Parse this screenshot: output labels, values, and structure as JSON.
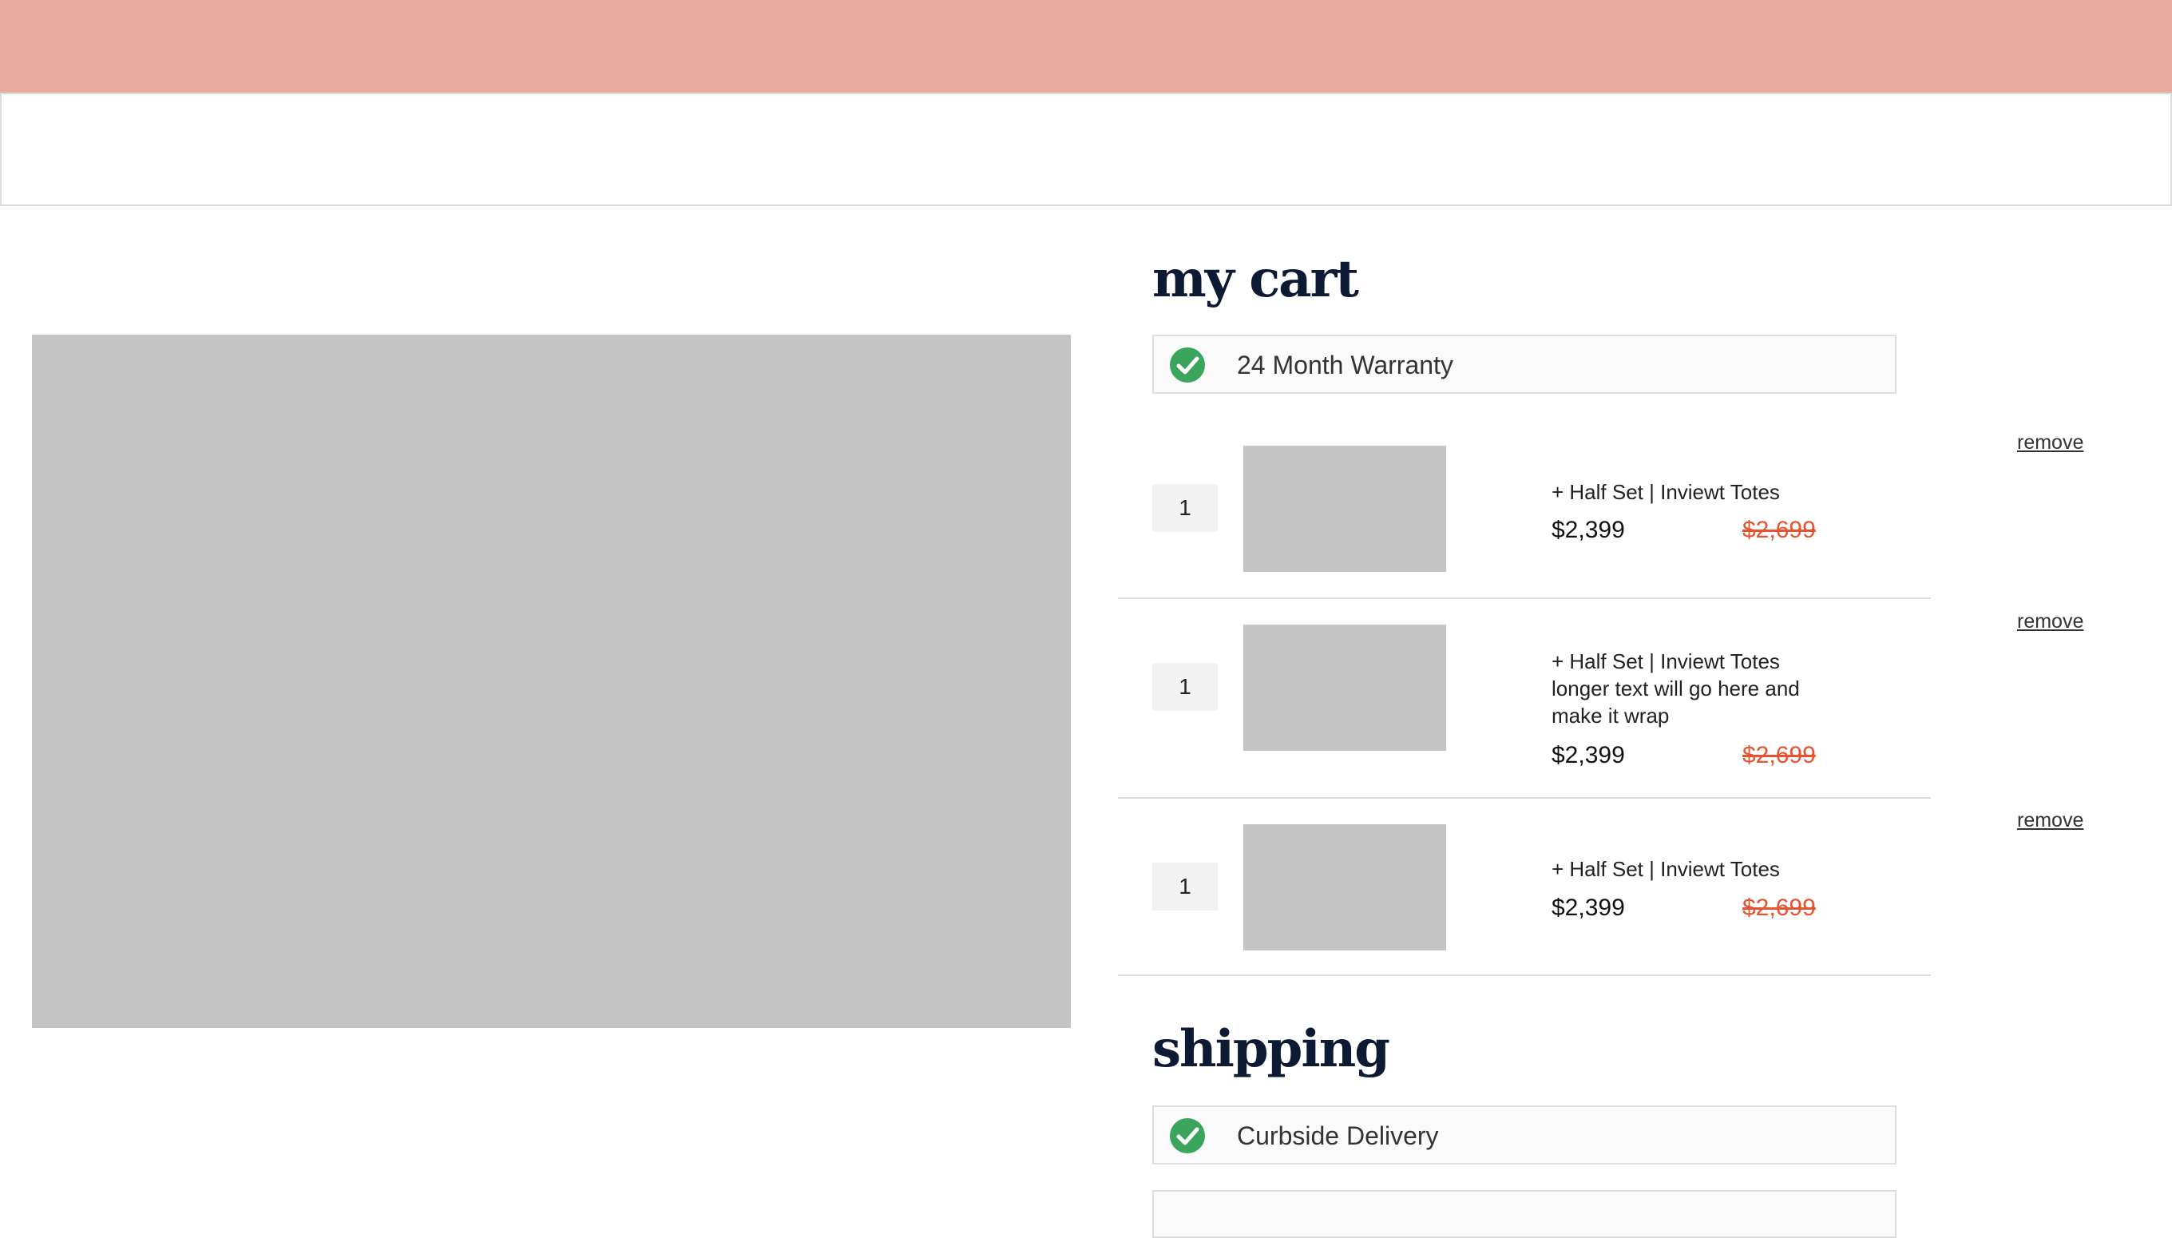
{
  "cart": {
    "title": "my cart",
    "warranty_label": "24 Month Warranty",
    "remove_label": "remove",
    "items": [
      {
        "qty": "1",
        "name": "+ Half Set | Inviewt Totes",
        "price": "$2,399",
        "old_price": "$2,699"
      },
      {
        "qty": "1",
        "name": "+ Half Set | Inviewt Totes longer text will go here and make it wrap",
        "price": "$2,399",
        "old_price": "$2,699"
      },
      {
        "qty": "1",
        "name": "+ Half Set | Inviewt Totes",
        "price": "$2,399",
        "old_price": "$2,699"
      }
    ]
  },
  "shipping": {
    "title": "shipping",
    "option_label": "Curbside Delivery"
  },
  "colors": {
    "top_banner": "#e9aaa1",
    "heading": "#0d1a33",
    "check": "#3ba55c",
    "sale_price": "#e8532f",
    "placeholder": "#c4c4c4"
  },
  "icons": {
    "check": "check-circle-icon"
  }
}
